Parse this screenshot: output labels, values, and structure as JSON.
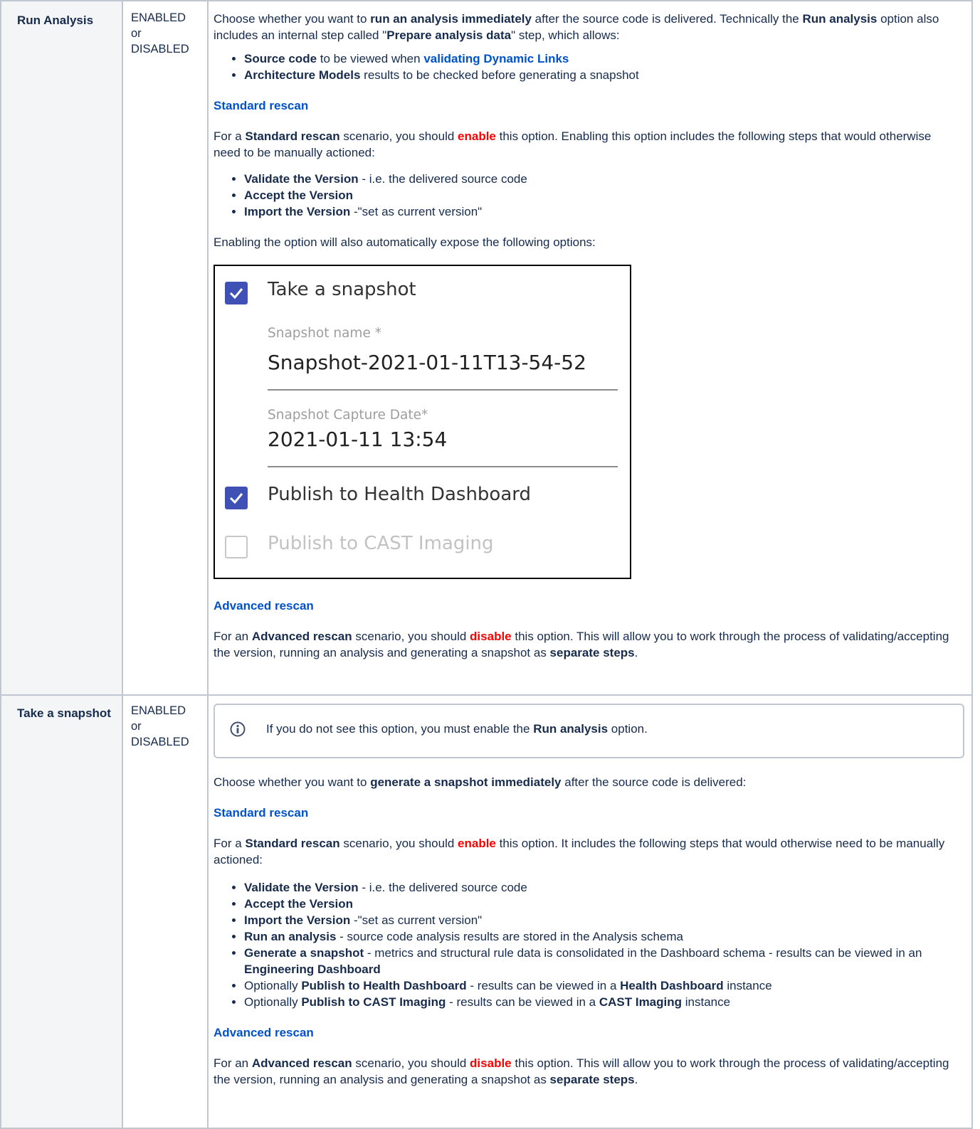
{
  "rows": [
    {
      "name": "Run Analysis",
      "state": [
        "ENABLED",
        "or",
        "DISABLED"
      ],
      "intro": {
        "t1": "Choose whether you want to ",
        "b1": "run an analysis immediately",
        "t2": " after the source code is delivered. Technically the ",
        "b2": "Run analysis",
        "t3": " option also includes an internal step called \"",
        "b3": "Prepare analysis data",
        "t4": "\" step, which allows:"
      },
      "bullets": [
        {
          "b": "Source code",
          "t": " to be viewed when ",
          "link": "validating Dynamic Links"
        },
        {
          "b": "Architecture Models",
          "t": " results to be checked before generating a snapshot"
        }
      ],
      "std_heading": "Standard rescan",
      "std": {
        "t1": "For a ",
        "b1": "Standard rescan",
        "t2": " scenario, you should ",
        "red": "enable",
        "t3": " this option. Enabling this option includes the following steps that would otherwise need to be manually actioned:"
      },
      "std_bullets": [
        {
          "b": "Validate the Version",
          "t": " - i.e. the delivered source code"
        },
        {
          "b": "Accept the Version",
          "t": ""
        },
        {
          "b": "Import the Version",
          "t": " -\"set as current version\""
        }
      ],
      "expose": "Enabling the option will also automatically expose the following options:",
      "screenshot": {
        "take_snapshot": "Take a snapshot",
        "name_label": "Snapshot name *",
        "name_value": "Snapshot-2021-01-11T13-54-52",
        "date_label": "Snapshot Capture Date*",
        "date_value": "2021-01-11 13:54",
        "publish_health": "Publish to Health Dashboard",
        "publish_imaging": "Publish to CAST Imaging"
      },
      "adv_heading": "Advanced rescan",
      "adv": {
        "t1": "For an ",
        "b1": "Advanced rescan",
        "t2": " scenario, you should ",
        "red": "disable",
        "t3": " this option. This will allow you to work through the process of validating/accepting the version, running an analysis and generating a snapshot as ",
        "b2": "separate steps",
        "t4": "."
      }
    },
    {
      "name": "Take a snapshot",
      "state": [
        "ENABLED",
        "or",
        "DISABLED"
      ],
      "note": {
        "t1": "If you do not see this option, you must enable the ",
        "b1": "Run analysis",
        "t2": " option."
      },
      "intro": {
        "t1": "Choose whether you want to ",
        "b1": "generate a snapshot immediately",
        "t2": " after the source code is delivered:"
      },
      "std_heading": "Standard rescan",
      "std": {
        "t1": "For a ",
        "b1": "Standard rescan",
        "t2": " scenario, you should ",
        "red": "enable",
        "t3": " this option. It includes the following steps that would otherwise need to be manually actioned:"
      },
      "std_bullets": [
        {
          "pre": "",
          "b": "Validate the Version",
          "t": " - i.e. the delivered source code",
          "b2": "",
          "t2": ""
        },
        {
          "pre": "",
          "b": "Accept the Version",
          "t": "",
          "b2": "",
          "t2": ""
        },
        {
          "pre": "",
          "b": "Import the Version",
          "t": " -\"set as current version\"",
          "b2": "",
          "t2": ""
        },
        {
          "pre": "",
          "b": "Run an analysis",
          "t": " - source code analysis results are stored in the Analysis schema",
          "b2": "",
          "t2": ""
        },
        {
          "pre": "",
          "b": "Generate a snapshot",
          "t": " - metrics and structural rule data is consolidated in the Dashboard schema - results can be viewed in an ",
          "b2": "Engineering Dashboard",
          "t2": ""
        },
        {
          "pre": "Optionally ",
          "b": "Publish to Health Dashboard",
          "t": " - results can be viewed in a ",
          "b2": "Health Dashboard",
          "t2": " instance"
        },
        {
          "pre": "Optionally ",
          "b": "Publish to CAST Imaging",
          "t": " - results can be viewed in a ",
          "b2": "CAST Imaging",
          "t2": " instance"
        }
      ],
      "adv_heading": "Advanced rescan",
      "adv": {
        "t1": "For an ",
        "b1": "Advanced rescan",
        "t2": " scenario, you should ",
        "red": "disable",
        "t3": " this option. This will allow you to work through the process of validating/accepting the version, running an analysis and generating a snapshot as ",
        "b2": "separate steps",
        "t4": "."
      }
    }
  ]
}
